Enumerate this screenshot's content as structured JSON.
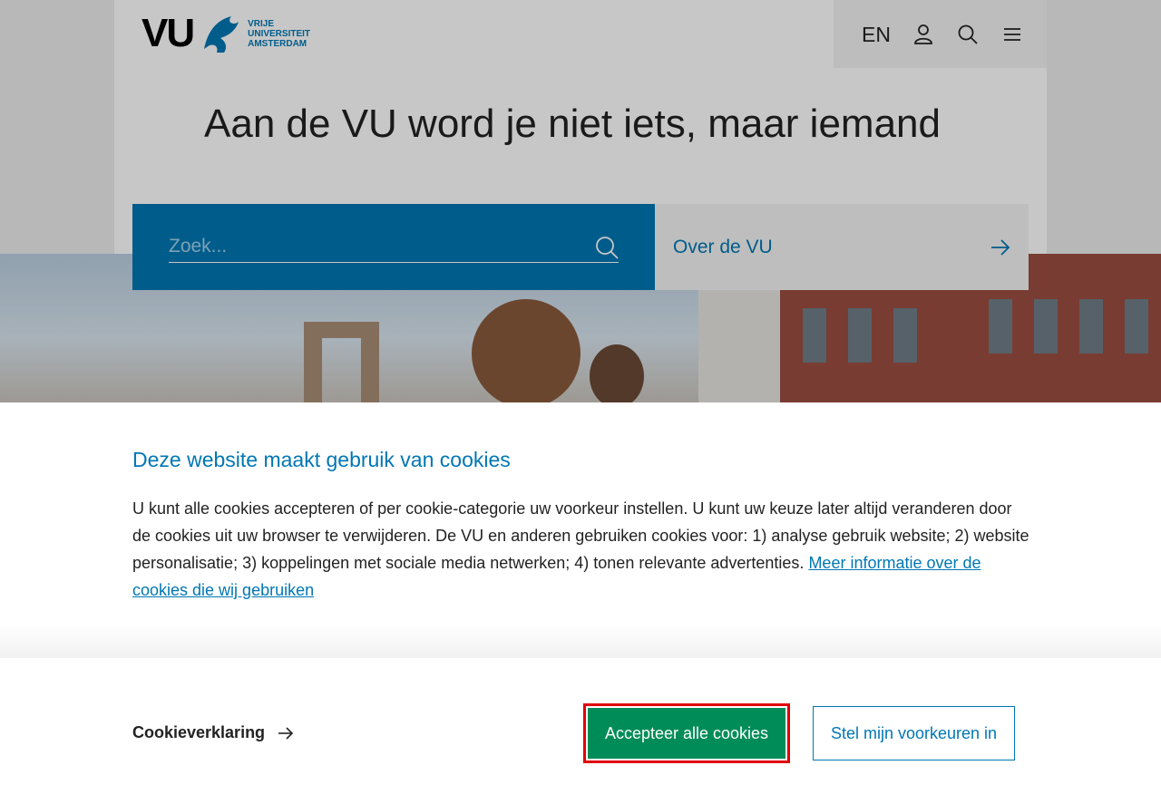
{
  "header": {
    "logo_mark": "VU",
    "logo_name_line1": "VRIJE",
    "logo_name_line2": "UNIVERSITEIT",
    "logo_name_line3": "AMSTERDAM",
    "language": "EN",
    "icons": [
      "user-icon",
      "search-icon",
      "menu-icon"
    ]
  },
  "hero": {
    "headline": "Aan de VU word je niet iets, maar iemand",
    "search_placeholder": "Zoek...",
    "about_link": "Over de VU"
  },
  "cookie": {
    "title": "Deze website maakt gebruik van cookies",
    "text": "U kunt alle cookies accepteren of per cookie-categorie uw voorkeur instellen. U kunt uw keuze later altijd veranderen door de cookies uit uw browser te verwijderen. De VU en anderen gebruiken cookies voor: 1) analyse gebruik website; 2) website personalisatie; 3) koppelingen met sociale media netwerken; 4) tonen relevante advertenties. ",
    "more_info_link": "Meer informatie over de cookies die wij gebruiken",
    "declaration_link": "Cookieverklaring",
    "accept_button": "Accepteer alle cookies",
    "prefs_button": "Stel mijn voorkeuren in"
  },
  "colors": {
    "brand_blue": "#0077b3",
    "accept_green": "#008c59",
    "highlight_red": "#e00000"
  }
}
